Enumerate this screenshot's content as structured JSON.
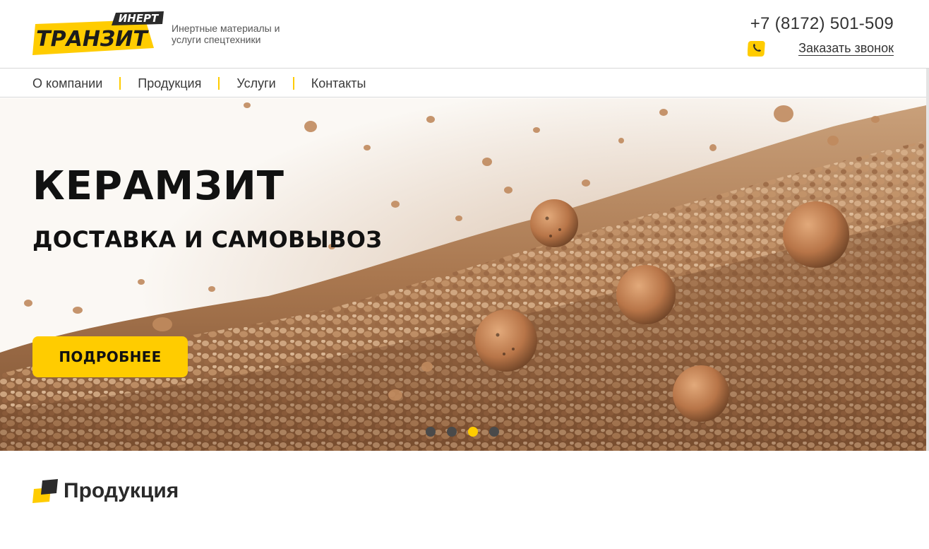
{
  "brand": {
    "logo_main": "ТРАНЗИТ",
    "logo_badge": "ИНЕРТ",
    "tagline": "Инертные материалы и услуги спецтехники",
    "accent_color": "#ffcc00",
    "dark_color": "#2b2b2b"
  },
  "contacts": {
    "phone": "+7 (8172) 501-509",
    "callback_label": "Заказать звонок",
    "callback_icon": "phone-icon"
  },
  "nav": {
    "items": [
      {
        "label": "О компании"
      },
      {
        "label": "Продукция"
      },
      {
        "label": "Услуги"
      },
      {
        "label": "Контакты"
      }
    ]
  },
  "hero": {
    "title": "КЕРАМЗИТ",
    "subtitle": "ДОСТАВКА И САМОВЫВОЗ",
    "button_label": "ПОДРОБНЕЕ",
    "slides_count": 4,
    "active_slide": 3
  },
  "products": {
    "title": "Продукция",
    "icon": "products-icon"
  }
}
